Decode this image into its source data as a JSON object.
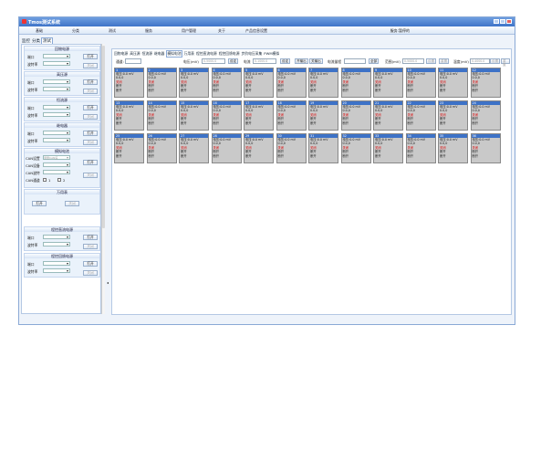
{
  "window": {
    "title": "Tmos测试系统",
    "minimize_label": "_",
    "maximize_label": "□",
    "close_label": "×"
  },
  "menu": [
    "基础",
    "分类",
    "测试",
    "服务",
    "用户管理",
    "关于",
    "产品信息设置"
  ],
  "status": "服务:暂停的",
  "top_tabs": [
    "监控",
    "分类",
    "测试"
  ],
  "left": {
    "s1": {
      "title": "回物电源",
      "port_label": "端口",
      "baud_label": "波特率",
      "open": "打开",
      "close": "关闭"
    },
    "s2": {
      "title": "高压源",
      "port_label": "端口",
      "baud_label": "波特率",
      "open": "打开",
      "close": "关闭"
    },
    "s3": {
      "title": "恒流源",
      "port_label": "端口",
      "baud_label": "波特率",
      "open": "打开",
      "close": "关闭"
    },
    "s4": {
      "title": "继电器",
      "port_label": "端口",
      "baud_label": "波特率",
      "open": "打开",
      "close": "关闭"
    },
    "s5": {
      "title": "模拟电池",
      "can_dev": "CAN设置",
      "can_dev_value": "测量CAN设",
      "can_idx": "CAN设备",
      "can_baud": "CAN波特",
      "can_ch": "CAN通道",
      "ch1": "1",
      "ch2": "2",
      "open": "打开",
      "close": "关闭"
    },
    "s6": {
      "title": "万用表",
      "open": "打开",
      "close": "关闭"
    },
    "s7": {
      "title": "程控直流电源",
      "port_label": "端口",
      "baud_label": "波特率",
      "open": "打开",
      "close": "关闭"
    },
    "s8": {
      "title": "程控回馈电源",
      "port_label": "端口",
      "baud_label": "波特率",
      "open": "打开",
      "close": "关闭"
    }
  },
  "main": {
    "tabs": [
      "回物电源",
      "高压源",
      "恒流源",
      "继电器",
      "模拟电池",
      "万用表",
      "程控直流电源",
      "程控回馈电源",
      "步阶电压采集",
      "PWM模拟"
    ],
    "ctrl": {
      "channel_label": "通道:",
      "voltage_label": "电压(mV)",
      "voltage_ph": "0-5000.0",
      "set": "设定",
      "current_label": "电流",
      "current_ph": "0-1000.0",
      "set2": "设定",
      "start": "开输出",
      "stop": "关输出",
      "range_label": "电流量程",
      "all": "全部",
      "range2_label": "范围(mV)",
      "range2_ph": "0-5000.0",
      "set3": "设置",
      "reset": "重置",
      "temp_label": "温度(mV)",
      "temp_ph": "0-4000.0",
      "set4": "设置",
      "reset2": "重置"
    },
    "cells": [
      {
        "id": "1",
        "v": "电压:0.0 mV",
        "i": "0.0,0",
        "s1": "关闭",
        "s2": "断开",
        "s3": "断开"
      },
      {
        "id": "2",
        "v": "电压:0.0 mV",
        "i": "0.0,0",
        "s1": "关闭",
        "s2": "断开",
        "s3": "断开"
      },
      {
        "id": "3",
        "v": "电压:0.0 mV",
        "i": "0.0,0",
        "s1": "关闭",
        "s2": "断开",
        "s3": "断开"
      },
      {
        "id": "4",
        "v": "电压:0.0 mV",
        "i": "0.0,0",
        "s1": "关闭",
        "s2": "断开",
        "s3": "断开"
      },
      {
        "id": "5",
        "v": "电压:0.0 mV",
        "i": "0.0,0",
        "s1": "关闭",
        "s2": "断开",
        "s3": "断开"
      },
      {
        "id": "6",
        "v": "电压:0.0 mV",
        "i": "0.0,0",
        "s1": "关闭",
        "s2": "断开",
        "s3": "断开"
      },
      {
        "id": "7",
        "v": "电压:0.0 mV",
        "i": "0.0,0",
        "s1": "关闭",
        "s2": "断开",
        "s3": "断开"
      },
      {
        "id": "8",
        "v": "电压:0.0 mV",
        "i": "0.0,0",
        "s1": "关闭",
        "s2": "断开",
        "s3": "断开"
      },
      {
        "id": "9",
        "v": "电压:0.0 mV",
        "i": "0.0,0",
        "s1": "关闭",
        "s2": "断开",
        "s3": "断开"
      },
      {
        "id": "10",
        "v": "电压:0.0 mV",
        "i": "0.0,0",
        "s1": "关闭",
        "s2": "断开",
        "s3": "断开"
      },
      {
        "id": "11",
        "v": "电压:0.0 mV",
        "i": "0.0,0",
        "s1": "关闭",
        "s2": "断开",
        "s3": "断开"
      },
      {
        "id": "12",
        "v": "电压:0.0 mV",
        "i": "0.0,0",
        "s1": "关闭",
        "s2": "断开",
        "s3": "断开"
      },
      {
        "id": "13",
        "v": "电压:0.0 mV",
        "i": "0.0,0",
        "s1": "关闭",
        "s2": "断开",
        "s3": "断开"
      },
      {
        "id": "14",
        "v": "电压:0.0 mV",
        "i": "0.0,0",
        "s1": "关闭",
        "s2": "断开",
        "s3": "断开"
      },
      {
        "id": "15",
        "v": "电压:0.0 mV",
        "i": "0.0,0",
        "s1": "关闭",
        "s2": "断开",
        "s3": "断开"
      },
      {
        "id": "16",
        "v": "电压:0.0 mV",
        "i": "0.0,0",
        "s1": "关闭",
        "s2": "断开",
        "s3": "断开"
      },
      {
        "id": "17",
        "v": "电压:0.0 mV",
        "i": "0.0,0",
        "s1": "关闭",
        "s2": "断开",
        "s3": "断开"
      },
      {
        "id": "18",
        "v": "电压:0.0 mV",
        "i": "0.0,0",
        "s1": "关闭",
        "s2": "断开",
        "s3": "断开"
      },
      {
        "id": "19",
        "v": "电压:0.0 mV",
        "i": "0.0,0",
        "s1": "关闭",
        "s2": "断开",
        "s3": "断开"
      },
      {
        "id": "20",
        "v": "电压:0.0 mV",
        "i": "0.0,0",
        "s1": "关闭",
        "s2": "断开",
        "s3": "断开"
      },
      {
        "id": "21",
        "v": "电压:0.0 mV",
        "i": "0.0,0",
        "s1": "关闭",
        "s2": "断开",
        "s3": "断开"
      },
      {
        "id": "22",
        "v": "电压:0.0 mV",
        "i": "0.0,0",
        "s1": "关闭",
        "s2": "断开",
        "s3": "断开"
      },
      {
        "id": "23",
        "v": "电压:0.0 mV",
        "i": "0.0,0",
        "s1": "关闭",
        "s2": "断开",
        "s3": "断开"
      },
      {
        "id": "24",
        "v": "电压:0.0 mV",
        "i": "0.0,0",
        "s1": "关闭",
        "s2": "断开",
        "s3": "断开"
      },
      {
        "id": "25",
        "v": "电压:0.0 mV",
        "i": "0.0,0",
        "s1": "关闭",
        "s2": "断开",
        "s3": "断开"
      },
      {
        "id": "26",
        "v": "电压:0.0 mV",
        "i": "0.0,0",
        "s1": "关闭",
        "s2": "断开",
        "s3": "断开"
      },
      {
        "id": "27",
        "v": "电压:0.0 mV",
        "i": "0.0,0",
        "s1": "关闭",
        "s2": "断开",
        "s3": "断开"
      },
      {
        "id": "28",
        "v": "电压:0.0 mV",
        "i": "0.0,0",
        "s1": "关闭",
        "s2": "断开",
        "s3": "断开"
      },
      {
        "id": "29",
        "v": "电压:0.0 mV",
        "i": "0.0,0",
        "s1": "关闭",
        "s2": "断开",
        "s3": "断开"
      },
      {
        "id": "30",
        "v": "电压:0.0 mV",
        "i": "0.0,0",
        "s1": "关闭",
        "s2": "断开",
        "s3": "断开"
      },
      {
        "id": "31",
        "v": "电压:0.0 mV",
        "i": "0.0,0",
        "s1": "关闭",
        "s2": "断开",
        "s3": "断开"
      },
      {
        "id": "32",
        "v": "电压:0.0 mV",
        "i": "0.0,0",
        "s1": "关闭",
        "s2": "断开",
        "s3": "断开"
      },
      {
        "id": "33",
        "v": "电压:0.0 mV",
        "i": "0.0,0",
        "s1": "关闭",
        "s2": "断开",
        "s3": "断开"
      },
      {
        "id": "34",
        "v": "电压:0.0 mV",
        "i": "0.0,0",
        "s1": "关闭",
        "s2": "断开",
        "s3": "断开"
      },
      {
        "id": "35",
        "v": "电压:0.0 mV",
        "i": "0.0,0",
        "s1": "关闭",
        "s2": "断开",
        "s3": "断开"
      },
      {
        "id": "36",
        "v": "电压:0.0 mV",
        "i": "0.0,0",
        "s1": "关闭",
        "s2": "断开",
        "s3": "断开"
      }
    ]
  },
  "scroll_arrow": "◂"
}
